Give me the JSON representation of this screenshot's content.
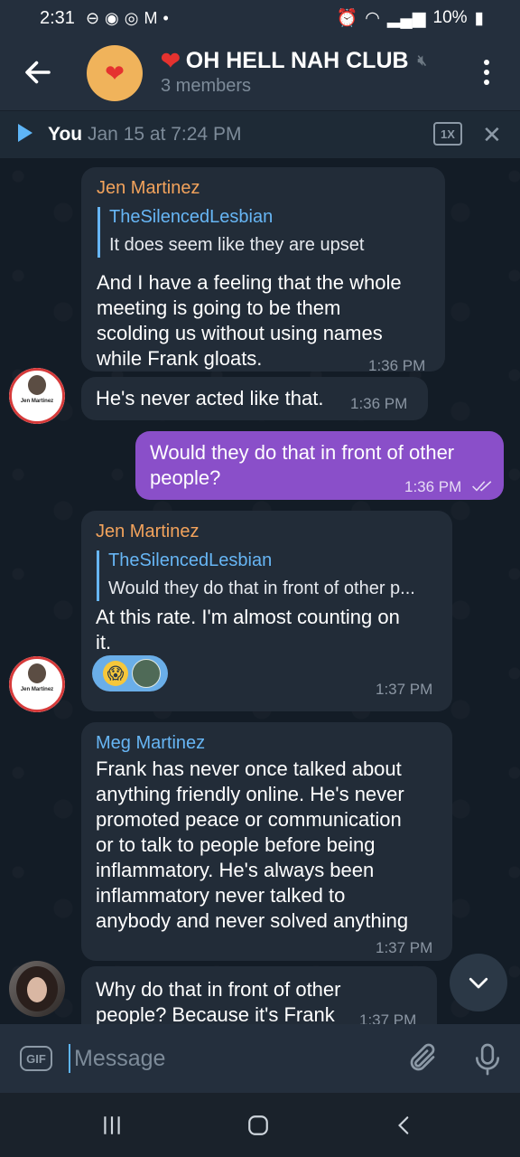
{
  "status_bar": {
    "time": "2:31",
    "battery": "10%"
  },
  "header": {
    "title": "OH HELL NAH CLUB",
    "subtitle": "3 members",
    "title_emoji": "❤️"
  },
  "audio_player": {
    "from": "You",
    "when": "Jan 15 at 7:24 PM",
    "speed": "1X"
  },
  "messages": [
    {
      "sender": "Jen Martinez",
      "reply_to": "TheSilencedLesbian",
      "reply_text": "It does seem like they are upset",
      "lines": [
        "And I have a feeling that the whole",
        "meeting is going to be them",
        "scolding us without using names",
        "while Frank gloats."
      ],
      "time": "1:36 PM"
    },
    {
      "text": "He's never acted like that.",
      "time": "1:36 PM",
      "avatar_name": "Jen Martinez"
    },
    {
      "lines": [
        "Would they do that in front of other",
        "people?"
      ],
      "time": "1:36 PM"
    },
    {
      "sender": "Jen Martinez",
      "reply_to": "TheSilencedLesbian",
      "reply_text": "Would they do that in front of other p...",
      "lines": [
        "At this rate. I'm almost counting on",
        "it."
      ],
      "time": "1:37 PM",
      "avatar_name": "Jen Martinez"
    },
    {
      "sender": "Meg Martinez",
      "lines": [
        "Frank has never once talked about",
        "anything friendly online. He's never",
        "promoted peace or communication",
        "or to talk to people before being",
        "inflammatory. He's always been",
        "inflammatory never talked to",
        "anybody and never solved anything"
      ],
      "time": "1:37 PM"
    },
    {
      "lines": [
        "Why do that in front of other",
        "people? Because it's Frank"
      ],
      "time": "1:37 PM"
    }
  ],
  "composer": {
    "placeholder": "Message",
    "gif_label": "GIF"
  },
  "colors": {
    "outgoing": "#8a4fc9",
    "incoming": "#222c38",
    "accent": "#5eb5f7",
    "sender_orange": "#f3a35c",
    "sender_blue": "#67b6f5"
  },
  "icons": {
    "back": "arrow-left-icon",
    "menu": "more-vertical-icon",
    "play": "play-icon",
    "close": "close-icon",
    "attach": "paperclip-icon",
    "mic": "microphone-icon",
    "scroll": "chevron-down-icon"
  }
}
